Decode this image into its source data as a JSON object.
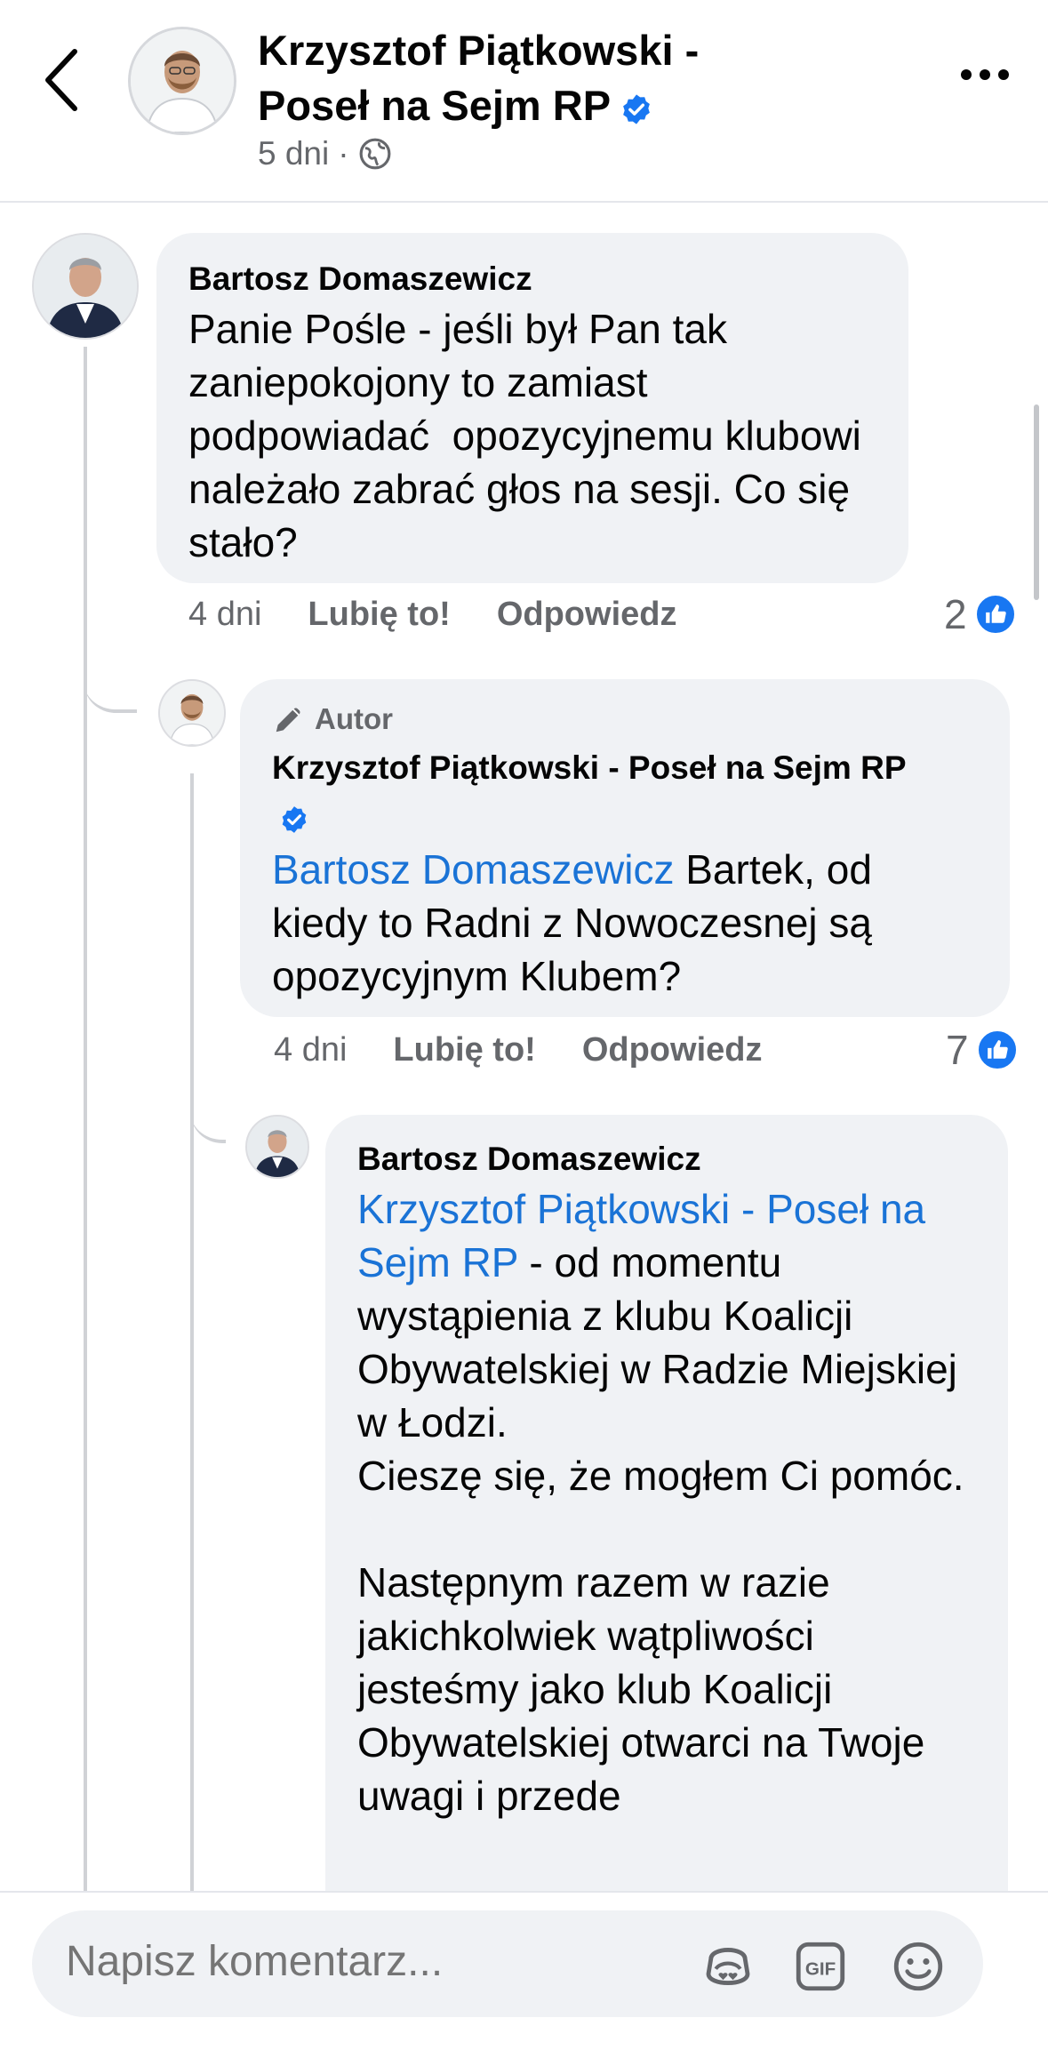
{
  "header": {
    "title": "Krzysztof Piątkowski - Poseł na Sejm RP",
    "time": "5 dni",
    "separator": "·"
  },
  "comments": [
    {
      "author": "Bartosz Domaszewicz",
      "text": "Panie Pośle - jeśli był Pan tak zaniepokojony to zamiast podpowiadać  opozycyjnemu klubowi należało zabrać głos na sesji. Co się stało?",
      "time": "4 dni",
      "like_label": "Lubię to!",
      "reply_label": "Odpowiedz",
      "reactions": "2"
    },
    {
      "author_badge": "Autor",
      "author": "Krzysztof Piątkowski - Poseł na Sejm RP",
      "mention": "Bartosz Domaszewicz",
      "text": " Bartek, od kiedy to Radni z Nowoczesnej są opozycyjnym Klubem?",
      "time": "4 dni",
      "like_label": "Lubię to!",
      "reply_label": "Odpowiedz",
      "reactions": "7"
    },
    {
      "author": "Bartosz Domaszewicz",
      "mention": "Krzysztof Piątkowski - Poseł na Sejm RP",
      "text": " - od momentu wystąpienia z klubu Koalicji Obywatelskiej w Radzie Miejskiej w Łodzi.\nCieszę się, że mogłem Ci pomóc.\n\nNastępnym razem w razie jakichkolwiek wątpliwości jesteśmy jako klub Koalicji Obywatelskiej otwarci na Twoje uwagi i przede"
    }
  ],
  "composer": {
    "placeholder": "Napisz komentarz..."
  },
  "icons": [
    "back-arrow-icon",
    "verified-icon",
    "globe-icon",
    "more-icon",
    "like-icon",
    "pencil-icon",
    "avatar-sticker-icon",
    "gif-icon",
    "emoji-icon"
  ],
  "colors": {
    "accent": "#1877f2",
    "mention": "#1a73d6",
    "bubble": "#f0f2f5",
    "muted": "#65676b"
  }
}
